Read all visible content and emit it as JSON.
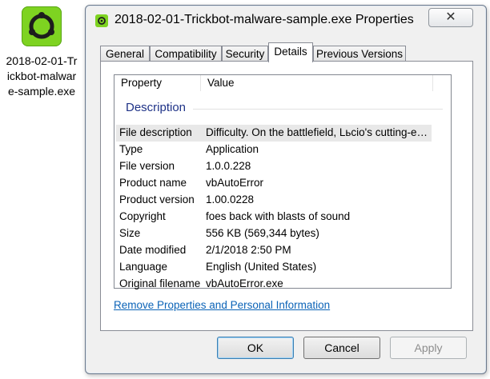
{
  "desktop": {
    "icon_name": "trickbot-app-icon",
    "caption": "2018-02-01-Trickbot-malware-sample.exe"
  },
  "window": {
    "title": "2018-02-01-Trickbot-malware-sample.exe Properties",
    "close_label": "✕"
  },
  "tabs": [
    {
      "label": "General"
    },
    {
      "label": "Compatibility"
    },
    {
      "label": "Security"
    },
    {
      "label": "Details"
    },
    {
      "label": "Previous Versions"
    }
  ],
  "details": {
    "col_property": "Property",
    "col_value": "Value",
    "group": "Description",
    "rows": [
      {
        "property": "File description",
        "value": "Difficulty. On the battlefield, Lьcio's cutting-edge..."
      },
      {
        "property": "Type",
        "value": "Application"
      },
      {
        "property": "File version",
        "value": "1.0.0.228"
      },
      {
        "property": "Product name",
        "value": "vbAutoError"
      },
      {
        "property": "Product version",
        "value": "1.00.0228"
      },
      {
        "property": "Copyright",
        "value": "foes back with blasts of sound"
      },
      {
        "property": "Size",
        "value": "556 KB (569,344 bytes)"
      },
      {
        "property": "Date modified",
        "value": "2/1/2018 2:50 PM"
      },
      {
        "property": "Language",
        "value": "English (United States)"
      },
      {
        "property": "Original filename",
        "value": "vbAutoError.exe"
      }
    ],
    "remove_link": "Remove Properties and Personal Information"
  },
  "buttons": {
    "ok": "OK",
    "cancel": "Cancel",
    "apply": "Apply"
  },
  "colors": {
    "icon_green": "#7ed321",
    "link_blue": "#0b63b7",
    "group_blue": "#1e3287"
  }
}
